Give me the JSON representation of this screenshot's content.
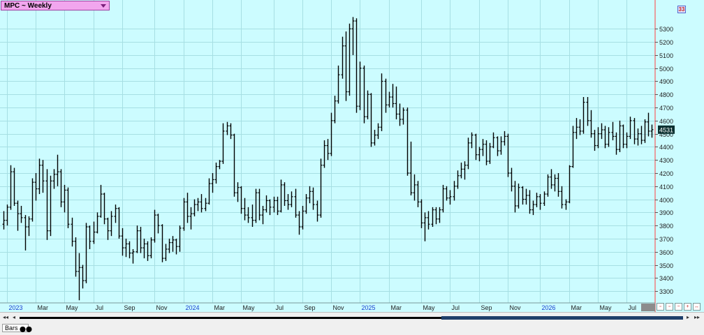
{
  "chart_title": "MPC ~ Weekly",
  "last_price_label": "4531",
  "corner_badge": "33",
  "footer": {
    "tab_label": "Bars"
  },
  "colors": {
    "background": "#ccfcff",
    "grid": "#a6dfe3",
    "bars": "#000000",
    "title_box": "#f2a6ee",
    "last_price_box": "#0b3030",
    "axis_text": "#222222",
    "year_label": "#1a3fd0",
    "right_boundary": "#ff4040"
  },
  "icons": [
    "chevron-down-icon",
    "scroll-left-icon",
    "scroll-right-icon",
    "zoom-in-icon",
    "zoom-out-icon",
    "chart-settings-icon"
  ],
  "chart_data": {
    "type": "ohlc",
    "title": "MPC ~ Weekly",
    "ylim": [
      3210,
      5520
    ],
    "y_ticks": [
      3300,
      3400,
      3500,
      3600,
      3700,
      3800,
      3900,
      4000,
      4100,
      4200,
      4300,
      4400,
      4500,
      4600,
      4700,
      4800,
      4900,
      5000,
      5100,
      5200,
      5300
    ],
    "x_labels": [
      "2023",
      "Mar",
      "May",
      "Jul",
      "Sep",
      "Nov",
      "2024",
      "Mar",
      "May",
      "Jul",
      "Sep",
      "Nov",
      "2025",
      "Mar",
      "May",
      "Jul",
      "Sep",
      "Nov",
      "2026",
      "Mar",
      "May",
      "Jul"
    ],
    "year_labels": [
      "2023",
      "2024",
      "2025",
      "2026"
    ],
    "last_value": 4531,
    "grid": true,
    "series": [
      {
        "bars": [
          [
            3810,
            3910,
            3770,
            3840
          ],
          [
            3840,
            3960,
            3800,
            3940
          ],
          [
            3940,
            4260,
            3920,
            4210
          ],
          [
            4210,
            4240,
            3950,
            3970
          ],
          [
            3970,
            3990,
            3760,
            3890
          ],
          [
            3890,
            3950,
            3820,
            3860
          ],
          [
            3860,
            3880,
            3610,
            3790
          ],
          [
            3790,
            3870,
            3720,
            3850
          ],
          [
            3850,
            4160,
            3830,
            4130
          ],
          [
            4130,
            4200,
            3990,
            4080
          ],
          [
            4080,
            4310,
            4040,
            4260
          ],
          [
            4260,
            4300,
            4050,
            4140
          ],
          [
            4140,
            4230,
            3690,
            3760
          ],
          [
            3760,
            4180,
            3720,
            4140
          ],
          [
            4140,
            4230,
            4080,
            4190
          ],
          [
            4190,
            4340,
            4100,
            4210
          ],
          [
            4210,
            4230,
            3940,
            3980
          ],
          [
            3980,
            4110,
            3900,
            4070
          ],
          [
            4070,
            4090,
            3780,
            3810
          ],
          [
            3810,
            3860,
            3640,
            3680
          ],
          [
            3680,
            3710,
            3410,
            3450
          ],
          [
            3450,
            3590,
            3230,
            3480
          ],
          [
            3480,
            3500,
            3320,
            3380
          ],
          [
            3380,
            3820,
            3360,
            3790
          ],
          [
            3790,
            3800,
            3620,
            3680
          ],
          [
            3680,
            3830,
            3660,
            3750
          ],
          [
            3750,
            3900,
            3740,
            3870
          ],
          [
            3870,
            4110,
            3860,
            4040
          ],
          [
            4040,
            4050,
            3810,
            3850
          ],
          [
            3850,
            3860,
            3690,
            3760
          ],
          [
            3760,
            3910,
            3720,
            3870
          ],
          [
            3870,
            3960,
            3820,
            3930
          ],
          [
            3930,
            3940,
            3700,
            3720
          ],
          [
            3720,
            3780,
            3570,
            3630
          ],
          [
            3630,
            3700,
            3560,
            3660
          ],
          [
            3660,
            3680,
            3550,
            3590
          ],
          [
            3590,
            3620,
            3510,
            3600
          ],
          [
            3600,
            3800,
            3590,
            3760
          ],
          [
            3760,
            3790,
            3590,
            3630
          ],
          [
            3630,
            3700,
            3550,
            3660
          ],
          [
            3660,
            3680,
            3530,
            3570
          ],
          [
            3570,
            3710,
            3550,
            3690
          ],
          [
            3690,
            3920,
            3670,
            3880
          ],
          [
            3880,
            3890,
            3740,
            3800
          ],
          [
            3800,
            3810,
            3520,
            3550
          ],
          [
            3550,
            3660,
            3530,
            3620
          ],
          [
            3620,
            3700,
            3590,
            3670
          ],
          [
            3670,
            3720,
            3600,
            3690
          ],
          [
            3690,
            3700,
            3580,
            3640
          ],
          [
            3640,
            3800,
            3600,
            3780
          ],
          [
            3780,
            4010,
            3760,
            3980
          ],
          [
            3980,
            4050,
            3820,
            3870
          ],
          [
            3870,
            3940,
            3770,
            3890
          ],
          [
            3890,
            4000,
            3870,
            3960
          ],
          [
            3960,
            4010,
            3910,
            3980
          ],
          [
            3980,
            4040,
            3900,
            3930
          ],
          [
            3930,
            4010,
            3910,
            3970
          ],
          [
            3970,
            4160,
            3960,
            4120
          ],
          [
            4120,
            4200,
            4050,
            4150
          ],
          [
            4150,
            4280,
            4120,
            4250
          ],
          [
            4250,
            4300,
            4230,
            4290
          ],
          [
            4290,
            4580,
            4270,
            4520
          ],
          [
            4520,
            4590,
            4490,
            4560
          ],
          [
            4560,
            4580,
            4460,
            4490
          ],
          [
            4490,
            4500,
            4020,
            4050
          ],
          [
            4050,
            4130,
            3980,
            4090
          ],
          [
            4090,
            4100,
            3890,
            3930
          ],
          [
            3930,
            4010,
            3840,
            3880
          ],
          [
            3880,
            3940,
            3820,
            3860
          ],
          [
            3860,
            3960,
            3790,
            3840
          ],
          [
            3840,
            4080,
            3820,
            4050
          ],
          [
            4050,
            4080,
            3840,
            3880
          ],
          [
            3880,
            3950,
            3810,
            3920
          ],
          [
            3920,
            4030,
            3900,
            3990
          ],
          [
            3990,
            4000,
            3880,
            3940
          ],
          [
            3940,
            4020,
            3900,
            3990
          ],
          [
            3990,
            4020,
            3880,
            3910
          ],
          [
            3910,
            4150,
            3900,
            4110
          ],
          [
            4110,
            4130,
            3950,
            3990
          ],
          [
            3990,
            4040,
            3920,
            3960
          ],
          [
            3960,
            4060,
            3940,
            4020
          ],
          [
            4020,
            4080,
            3860,
            3880
          ],
          [
            3880,
            3910,
            3730,
            3790
          ],
          [
            3790,
            3950,
            3770,
            3910
          ],
          [
            3910,
            4040,
            3890,
            4010
          ],
          [
            4010,
            4100,
            3970,
            4060
          ],
          [
            4060,
            4090,
            3920,
            3960
          ],
          [
            3960,
            3990,
            3830,
            3880
          ],
          [
            3880,
            4310,
            3860,
            4260
          ],
          [
            4260,
            4450,
            4240,
            4410
          ],
          [
            4410,
            4460,
            4300,
            4350
          ],
          [
            4350,
            4660,
            4330,
            4600
          ],
          [
            4600,
            4790,
            4580,
            4750
          ],
          [
            4750,
            5020,
            4730,
            4950
          ],
          [
            4950,
            5240,
            4920,
            5170
          ],
          [
            5170,
            5280,
            4750,
            4820
          ],
          [
            4820,
            5340,
            4790,
            5300
          ],
          [
            5300,
            5390,
            5100,
            5360
          ],
          [
            5360,
            5380,
            4660,
            4710
          ],
          [
            4710,
            5050,
            4680,
            5000
          ],
          [
            5000,
            5020,
            4580,
            4630
          ],
          [
            4630,
            4830,
            4610,
            4800
          ],
          [
            4800,
            4810,
            4400,
            4430
          ],
          [
            4430,
            4530,
            4410,
            4490
          ],
          [
            4490,
            4580,
            4460,
            4550
          ],
          [
            4550,
            4960,
            4520,
            4900
          ],
          [
            4900,
            4920,
            4660,
            4720
          ],
          [
            4720,
            4820,
            4700,
            4780
          ],
          [
            4780,
            4880,
            4700,
            4730
          ],
          [
            4730,
            4860,
            4610,
            4650
          ],
          [
            4650,
            4730,
            4560,
            4610
          ],
          [
            4610,
            4700,
            4570,
            4680
          ],
          [
            4680,
            4700,
            4180,
            4200
          ],
          [
            4200,
            4440,
            4030,
            4050
          ],
          [
            4050,
            4190,
            3990,
            4110
          ],
          [
            4110,
            4140,
            3940,
            3980
          ],
          [
            3980,
            4000,
            3780,
            3820
          ],
          [
            3820,
            3900,
            3680,
            3860
          ],
          [
            3860,
            3910,
            3770,
            3810
          ],
          [
            3810,
            3940,
            3790,
            3920
          ],
          [
            3920,
            3940,
            3810,
            3850
          ],
          [
            3850,
            3940,
            3820,
            3920
          ],
          [
            3920,
            4110,
            3900,
            4080
          ],
          [
            4080,
            4100,
            3990,
            4010
          ],
          [
            4010,
            4070,
            3960,
            4020
          ],
          [
            4020,
            4140,
            3990,
            4100
          ],
          [
            4100,
            4220,
            4080,
            4180
          ],
          [
            4180,
            4280,
            4160,
            4230
          ],
          [
            4230,
            4290,
            4150,
            4260
          ],
          [
            4260,
            4470,
            4230,
            4430
          ],
          [
            4430,
            4510,
            4390,
            4490
          ],
          [
            4490,
            4500,
            4300,
            4340
          ],
          [
            4340,
            4400,
            4290,
            4380
          ],
          [
            4380,
            4460,
            4330,
            4420
          ],
          [
            4420,
            4450,
            4260,
            4290
          ],
          [
            4290,
            4430,
            4270,
            4400
          ],
          [
            4400,
            4510,
            4390,
            4470
          ],
          [
            4470,
            4480,
            4330,
            4370
          ],
          [
            4370,
            4480,
            4340,
            4440
          ],
          [
            4440,
            4520,
            4410,
            4480
          ],
          [
            4480,
            4500,
            4170,
            4200
          ],
          [
            4200,
            4240,
            4060,
            4100
          ],
          [
            4100,
            4140,
            3900,
            3950
          ],
          [
            3950,
            4120,
            3930,
            4090
          ],
          [
            4090,
            4100,
            3960,
            4000
          ],
          [
            4000,
            4080,
            3960,
            4030
          ],
          [
            4030,
            4070,
            3890,
            3920
          ],
          [
            3920,
            3990,
            3880,
            3960
          ],
          [
            3960,
            4050,
            3940,
            4020
          ],
          [
            4020,
            4040,
            3920,
            3970
          ],
          [
            3970,
            4060,
            3950,
            4040
          ],
          [
            4040,
            4190,
            4020,
            4170
          ],
          [
            4170,
            4230,
            4080,
            4110
          ],
          [
            4110,
            4190,
            4060,
            4160
          ],
          [
            4160,
            4200,
            4020,
            4060
          ],
          [
            4060,
            4100,
            3930,
            3960
          ],
          [
            3960,
            4000,
            3920,
            3980
          ],
          [
            3980,
            4260,
            3970,
            4250
          ],
          [
            4250,
            4560,
            4240,
            4510
          ],
          [
            4510,
            4620,
            4460,
            4550
          ],
          [
            4550,
            4610,
            4490,
            4520
          ],
          [
            4520,
            4780,
            4500,
            4740
          ],
          [
            4740,
            4780,
            4560,
            4600
          ],
          [
            4600,
            4680,
            4470,
            4500
          ],
          [
            4500,
            4530,
            4370,
            4410
          ],
          [
            4410,
            4550,
            4390,
            4500
          ],
          [
            4500,
            4580,
            4460,
            4530
          ],
          [
            4530,
            4560,
            4390,
            4420
          ],
          [
            4420,
            4550,
            4400,
            4510
          ],
          [
            4510,
            4590,
            4450,
            4480
          ],
          [
            4480,
            4510,
            4340,
            4380
          ],
          [
            4380,
            4600,
            4360,
            4560
          ],
          [
            4560,
            4570,
            4390,
            4420
          ],
          [
            4420,
            4510,
            4390,
            4480
          ],
          [
            4480,
            4630,
            4460,
            4600
          ],
          [
            4600,
            4620,
            4420,
            4460
          ],
          [
            4460,
            4540,
            4410,
            4500
          ],
          [
            4500,
            4560,
            4420,
            4450
          ],
          [
            4450,
            4610,
            4430,
            4590
          ],
          [
            4590,
            4660,
            4480,
            4520
          ],
          [
            4520,
            4570,
            4470,
            4531
          ]
        ]
      }
    ]
  }
}
